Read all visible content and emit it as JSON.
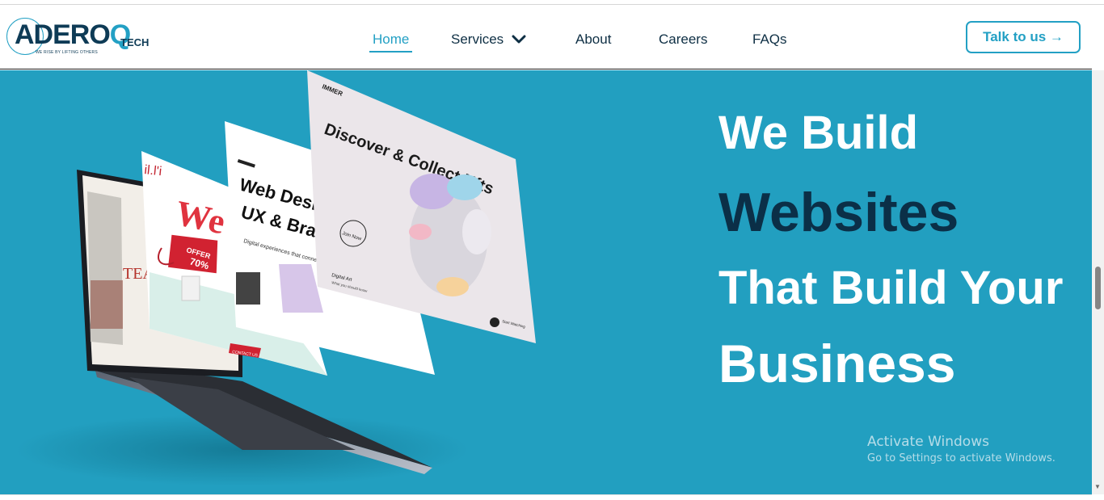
{
  "brand": {
    "name_part1": "ADERO",
    "name_part2": "Q",
    "suffix": "TECH",
    "tagline": "WE RISE BY LIFTING OTHERS"
  },
  "nav": {
    "items": [
      {
        "label": "Home",
        "active": true
      },
      {
        "label": "Services",
        "has_dropdown": true
      },
      {
        "label": "About"
      },
      {
        "label": "Careers"
      },
      {
        "label": "FAQs"
      }
    ],
    "cta_label": "Talk to us →"
  },
  "hero": {
    "background": "#229fc0",
    "lines": [
      "We Build",
      "Websites",
      "That Build Your",
      "Business"
    ],
    "mockups": {
      "card_left": {
        "brand": "il.l'i",
        "big": "We",
        "badge_offer": "OFFER",
        "badge_value": "70%",
        "contact": "CONTACT US"
      },
      "card_middle": {
        "title_1": "Web Design",
        "title_2": "UX & Brandi",
        "subtitle": "Digital experiences that connect"
      },
      "card_front": {
        "brand": "IMMER",
        "title": "Discover & Collect Nfts",
        "button": "Join Now",
        "section": "Digital Art",
        "section_sub": "What you should know",
        "bottom": "Start Watching"
      },
      "laptop_text": {
        "brand": "TEA"
      }
    }
  },
  "watermark": {
    "title": "Activate Windows",
    "subtitle": "Go to Settings to activate Windows."
  },
  "colors": {
    "accent": "#23a0c4",
    "dark_navy": "#0e3b56",
    "hero_highlight": "#0b2f47"
  }
}
